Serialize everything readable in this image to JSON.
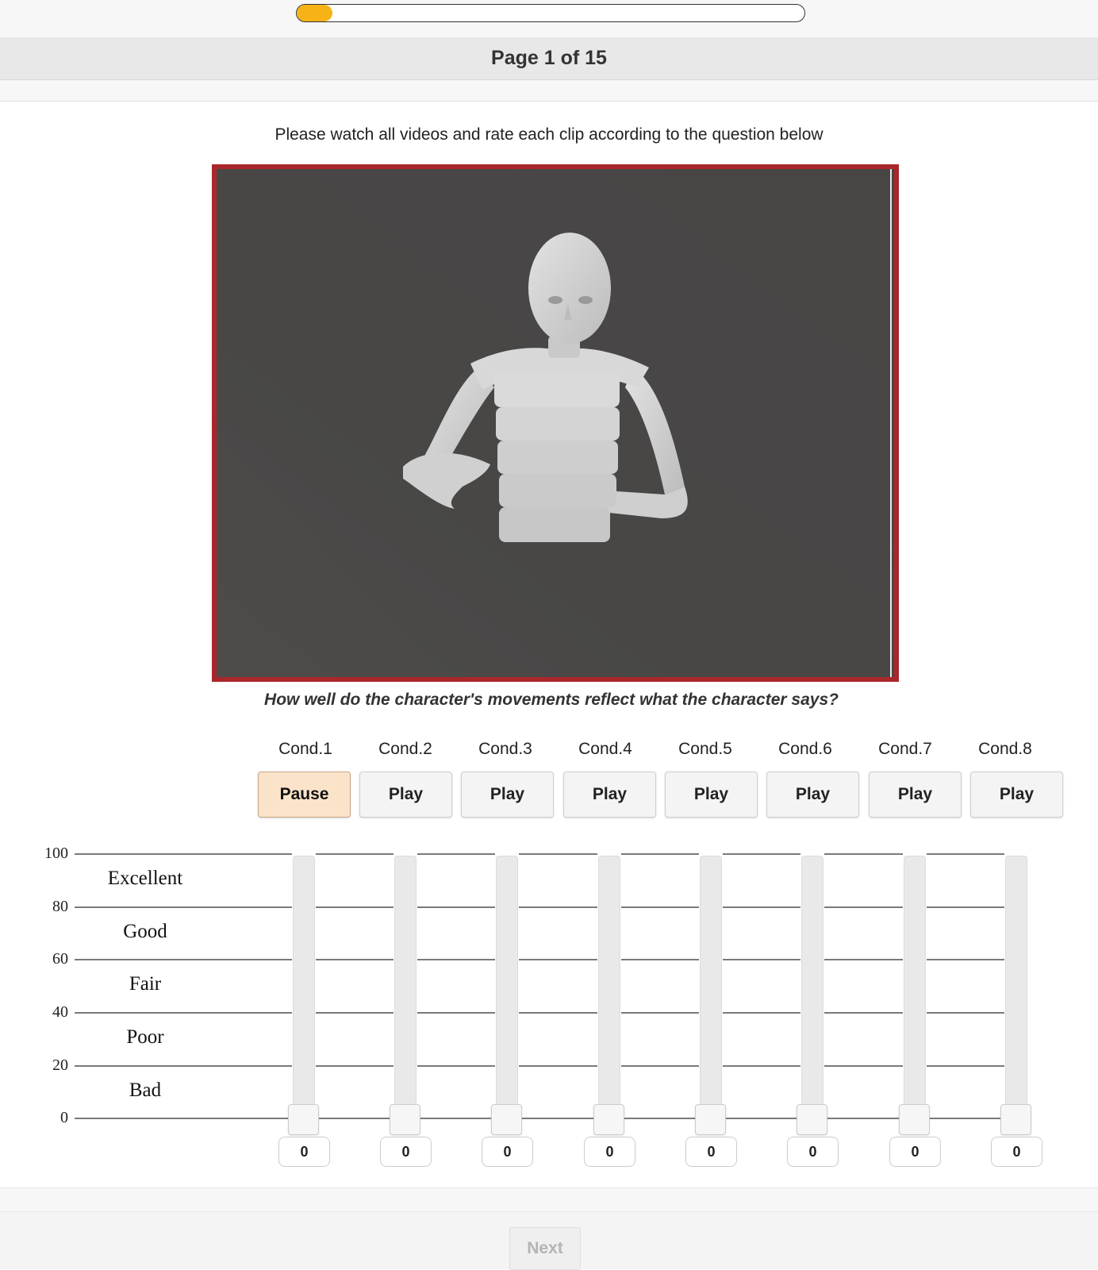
{
  "progress": {
    "fraction": 0.07
  },
  "header": {
    "title": "Page 1 of 15"
  },
  "instruction": "Please watch all videos and rate each clip according to the question below",
  "question": "How well do the character's movements reflect what the character says?",
  "colors": {
    "accent": "#f7b316",
    "frame": "#a9272b",
    "video_bg": "#484746",
    "active_button": "#fbe3c9"
  },
  "conditions": [
    {
      "label": "Cond.1",
      "button": "Pause",
      "value": "0"
    },
    {
      "label": "Cond.2",
      "button": "Play",
      "value": "0"
    },
    {
      "label": "Cond.3",
      "button": "Play",
      "value": "0"
    },
    {
      "label": "Cond.4",
      "button": "Play",
      "value": "0"
    },
    {
      "label": "Cond.5",
      "button": "Play",
      "value": "0"
    },
    {
      "label": "Cond.6",
      "button": "Play",
      "value": "0"
    },
    {
      "label": "Cond.7",
      "button": "Play",
      "value": "0"
    },
    {
      "label": "Cond.8",
      "button": "Play",
      "value": "0"
    }
  ],
  "scale": {
    "ticks": [
      "100",
      "80",
      "60",
      "40",
      "20",
      "0"
    ],
    "categories": [
      "Excellent",
      "Good",
      "Fair",
      "Poor",
      "Bad"
    ]
  },
  "footer": {
    "next_label": "Next"
  }
}
